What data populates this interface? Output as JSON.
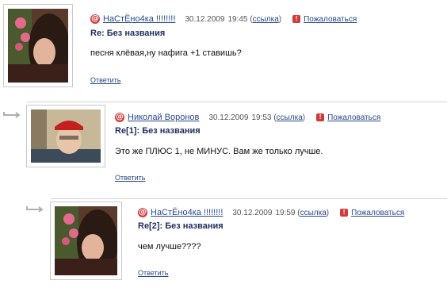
{
  "comments": [
    {
      "user": "НаСтЁно4ка !!!!!!!!",
      "date": "30.12.2009",
      "time": "19:45",
      "link": "ссылка",
      "report": "Пожаловаться",
      "title": "Re: Без названия",
      "text": "песня клёвая,ну нафига +1 ставишь?",
      "reply": "Ответить",
      "avatar_icon": "girl-with-roses-photo"
    },
    {
      "user": "Николай Воронов",
      "date": "30.12.2009",
      "time": "19:53",
      "link": "ссылка",
      "report": "Пожаловаться",
      "title": "Re[1]: Без названия",
      "text": "Это же ПЛЮС 1, не МИНУС. Вам же только лучше.",
      "reply": "Ответить",
      "avatar_icon": "boy-red-cap-photo"
    },
    {
      "user": "НаСтЁно4ка !!!!!!!!",
      "date": "30.12.2009",
      "time": "19:59",
      "link": "ссылка",
      "report": "Пожаловаться",
      "title": "Re[2]: Без названия",
      "text": "чем лучше????",
      "reply": "Ответить",
      "avatar_icon": "girl-with-roses-photo"
    }
  ],
  "colors": {
    "link": "#2a4a8c",
    "accent_red": "#d23b3b",
    "title": "#1f2f5f"
  }
}
